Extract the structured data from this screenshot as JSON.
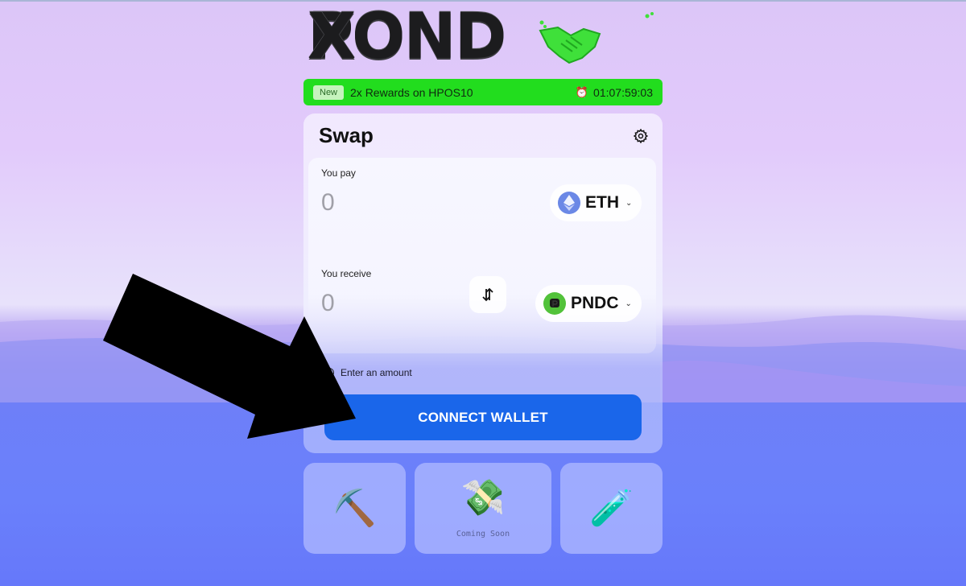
{
  "brand": {
    "logo_text_left": "POND",
    "logo_text_right": "X",
    "logo_icon": "handshake-icon"
  },
  "promo": {
    "badge": "New",
    "text": "2x Rewards on HPOS10",
    "clock_icon": "⏰",
    "timer": "01:07:59:03",
    "color": "#22dd1e"
  },
  "swap": {
    "title": "Swap",
    "settings_icon": "gear-icon",
    "pay": {
      "label": "You pay",
      "amount_placeholder": "0",
      "token": "ETH",
      "token_icon": "ethereum-icon"
    },
    "receive": {
      "label": "You receive",
      "amount_placeholder": "0",
      "token": "PNDC",
      "token_icon": "pndc-icon"
    },
    "flip_icon": "swap-vertical-icon",
    "hint": "Enter an amount",
    "connect_label": "CONNECT WALLET",
    "accent": "#1a66ea"
  },
  "tiles": [
    {
      "icon": "⛏️",
      "icon_name": "pickaxe-icon",
      "caption": ""
    },
    {
      "icon": "💸",
      "icon_name": "money-wings-icon",
      "caption": "Coming Soon"
    },
    {
      "icon": "🧪",
      "icon_name": "test-tube-icon",
      "caption": ""
    }
  ],
  "annotation": {
    "arrow": "pointer-arrow pointing to connect wallet button"
  }
}
